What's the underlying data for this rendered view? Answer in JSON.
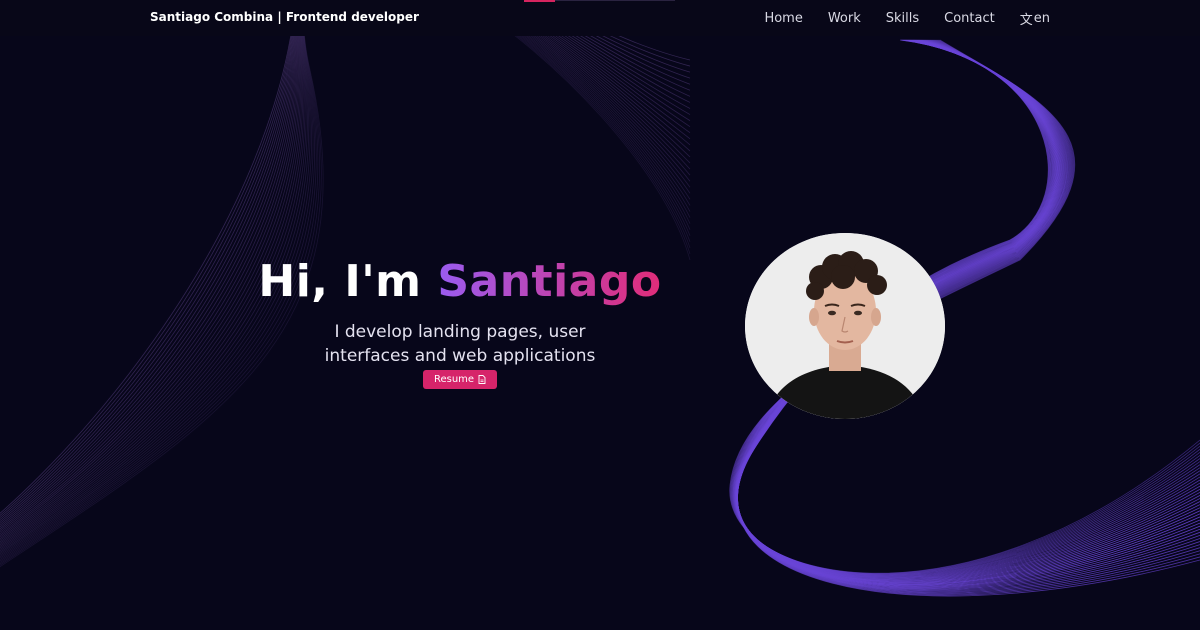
{
  "header": {
    "brand": "Santiago Combina | Frontend developer",
    "nav": [
      {
        "label": "Home"
      },
      {
        "label": "Work"
      },
      {
        "label": "Skills"
      },
      {
        "label": "Contact"
      }
    ],
    "language": {
      "icon": "translate-icon",
      "label": "en"
    }
  },
  "hero": {
    "greeting": "Hi, I'm ",
    "name": "Santiago",
    "subtitle_line1": "I develop landing pages, user",
    "subtitle_line2": "interfaces and web applications",
    "resume_label": "Resume",
    "resume_icon": "document-icon"
  },
  "avatar": {
    "icon": "profile-photo"
  },
  "colors": {
    "background": "#07061a",
    "accent_purple": "#9a5cf0",
    "accent_pink": "#d6246a",
    "line_left": "#3a2a5c",
    "line_right": "#6b46d9"
  }
}
